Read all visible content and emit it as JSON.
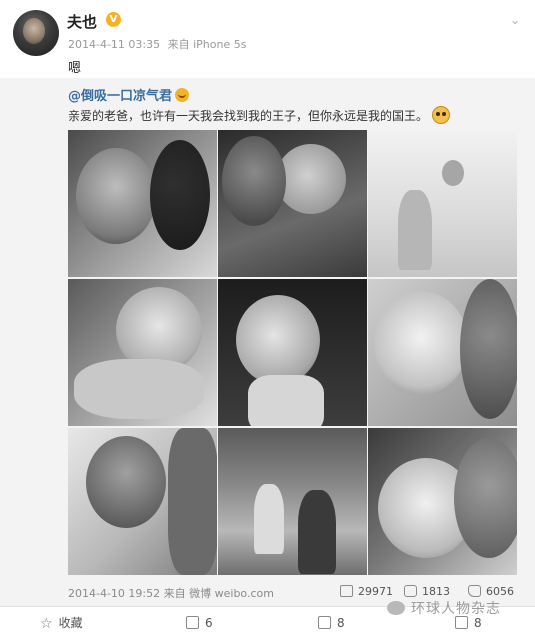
{
  "post": {
    "username": "夫也",
    "verified_badge": "V",
    "timestamp": "2014-4-11 03:35",
    "source": "来自 iPhone 5s",
    "text": "嗯",
    "menu_icon": "chevron-down-icon"
  },
  "repost": {
    "original_user": "@倒吸一口凉气君",
    "original_text": "亲爱的老爸，也许有一天我会找到我的王子，但你永远是我的国王。",
    "photos_count": 9,
    "timestamp": "2014-4-10 19:52",
    "source": "来自 微博 weibo.com",
    "reposts": "29971",
    "comments": "1813",
    "likes": "6056"
  },
  "toolbar": {
    "favorite_label": "收藏",
    "repost_count": "6",
    "comment_count": "8",
    "like_count": "8"
  },
  "watermark": "环球人物杂志",
  "colors": {
    "link": "#3a6fa0",
    "verified": "#f6b226",
    "repost_bg": "#f3f3f3"
  }
}
